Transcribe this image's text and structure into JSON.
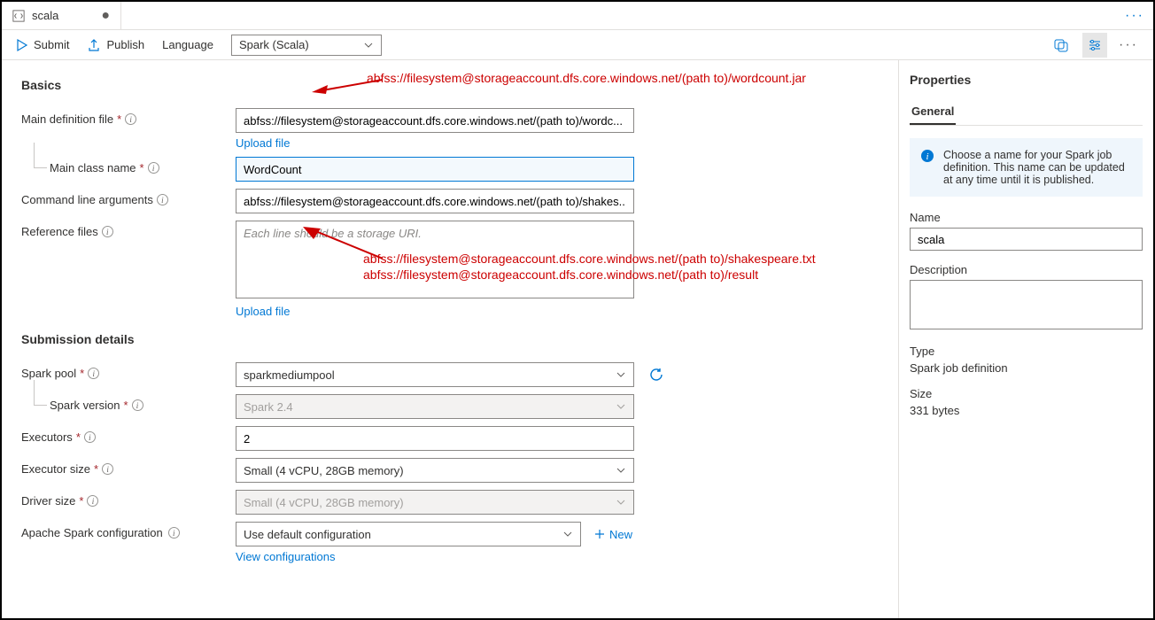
{
  "tab": {
    "title": "scala"
  },
  "toolbar": {
    "submit": "Submit",
    "publish": "Publish",
    "lang_label": "Language",
    "lang_value": "Spark (Scala)"
  },
  "sections": {
    "basics": "Basics",
    "submission": "Submission details"
  },
  "labels": {
    "main_def": "Main definition file",
    "main_class": "Main class name",
    "cmd_args": "Command line arguments",
    "ref_files": "Reference files",
    "spark_pool": "Spark pool",
    "spark_version": "Spark version",
    "executors": "Executors",
    "executor_size": "Executor size",
    "driver_size": "Driver size",
    "spark_conf": "Apache Spark configuration"
  },
  "values": {
    "main_def": "abfss://filesystem@storageaccount.dfs.core.windows.net/(path to)/wordc...",
    "main_class": "WordCount",
    "cmd_args": "abfss://filesystem@storageaccount.dfs.core.windows.net/(path to)/shakes...",
    "ref_placeholder": "Each line should be a storage URI.",
    "spark_pool": "sparkmediumpool",
    "spark_version": "Spark 2.4",
    "executors": "2",
    "executor_size": "Small (4 vCPU, 28GB memory)",
    "driver_size": "Small (4 vCPU, 28GB memory)",
    "spark_conf": "Use default configuration"
  },
  "links": {
    "upload": "Upload file",
    "view_conf": "View configurations",
    "new": "New"
  },
  "annotations": {
    "a1": "abfss://filesystem@storageaccount.dfs.core.windows.net/(path to)/wordcount.jar",
    "a2": "abfss://filesystem@storageaccount.dfs.core.windows.net/(path to)/shakespeare.txt",
    "a3": "abfss://filesystem@storageaccount.dfs.core.windows.net/(path to)/result"
  },
  "properties": {
    "title": "Properties",
    "tab_general": "General",
    "help": "Choose a name for your Spark job definition. This name can be updated at any time until it is published.",
    "name_label": "Name",
    "name_value": "scala",
    "desc_label": "Description",
    "type_label": "Type",
    "type_value": "Spark job definition",
    "size_label": "Size",
    "size_value": "331 bytes"
  }
}
